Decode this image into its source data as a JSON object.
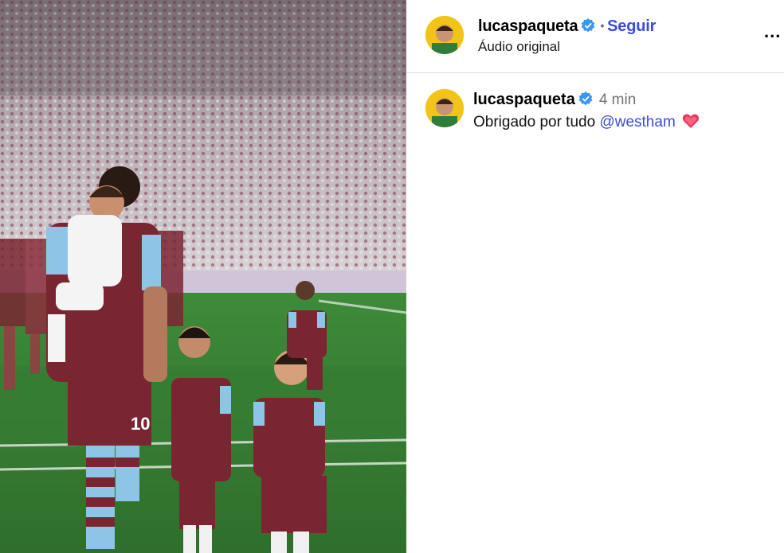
{
  "post": {
    "username": "lucaspaqueta",
    "follow_label": "Seguir",
    "separator": "•",
    "audio_label": "Áudio original",
    "more_label": "..."
  },
  "comment": {
    "username": "lucaspaqueta",
    "time": "4 min",
    "text": "Obrigado por tudo",
    "mention": "@westham"
  },
  "colors": {
    "link": "#3b4bdb",
    "verified": "#3897f0",
    "kit_claret": "#7a2632",
    "kit_blue": "#8ec5e6",
    "pitch": "#3a7a38"
  },
  "icons": [
    "verified-badge-icon",
    "heart-icon",
    "more-options-icon"
  ]
}
